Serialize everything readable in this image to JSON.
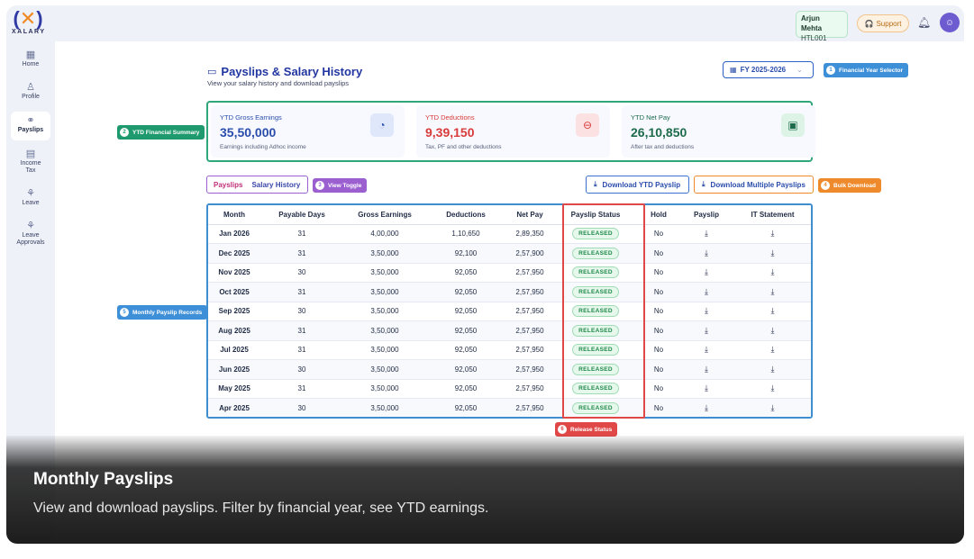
{
  "brand": {
    "logo_word": "XALARY"
  },
  "header": {
    "user_name": "Arjun Mehta",
    "user_id": "HTL001",
    "support_label": "Support"
  },
  "sidebar": {
    "items": [
      {
        "label": "Home",
        "icon": "grid-icon"
      },
      {
        "label": "Profile",
        "icon": "user-icon"
      },
      {
        "label": "Payslips",
        "icon": "payslip-icon",
        "active": true
      },
      {
        "label": "Income Tax",
        "icon": "calculator-icon"
      },
      {
        "label": "Leave",
        "icon": "leave-icon"
      },
      {
        "label": "Leave Approvals",
        "icon": "leave-approval-icon"
      }
    ]
  },
  "page": {
    "title": "Payslips & Salary History",
    "subtitle": "View your salary history and download payslips",
    "fy_select": "FY 2025-2026"
  },
  "summary": {
    "gross": {
      "label": "YTD Gross Earnings",
      "value": "35,50,000",
      "note": "Earnings including Adhoc income"
    },
    "deductions": {
      "label": "YTD Deductions",
      "value": "9,39,150",
      "note": "Tax, PF and other deductions"
    },
    "net": {
      "label": "YTD Net Pay",
      "value": "26,10,850",
      "note": "After tax and deductions"
    }
  },
  "toggle": {
    "payslips": "Payslips",
    "history": "Salary History"
  },
  "buttons": {
    "download_ytd": "Download YTD Payslip",
    "download_multiple": "Download Multiple Payslips"
  },
  "callouts": {
    "c1": {
      "num": "1",
      "label": "Financial Year Selector"
    },
    "c2": {
      "num": "2",
      "label": "YTD Financial Summary"
    },
    "c3": {
      "num": "3",
      "label": "View Toggle"
    },
    "c4": {
      "num": "4",
      "label": "Bulk Download"
    },
    "c5": {
      "num": "5",
      "label": "Monthly Payslip Records"
    },
    "c6": {
      "num": "6",
      "label": "Release Status"
    }
  },
  "table": {
    "headers": [
      "Month",
      "Payable Days",
      "Gross Earnings",
      "Deductions",
      "Net Pay",
      "Payslip Status",
      "Hold",
      "Payslip",
      "IT Statement"
    ],
    "rows": [
      {
        "month": "Jan 2026",
        "days": "31",
        "gross": "4,00,000",
        "deductions": "1,10,650",
        "net": "2,89,350",
        "status": "RELEASED",
        "hold": "No"
      },
      {
        "month": "Dec 2025",
        "days": "31",
        "gross": "3,50,000",
        "deductions": "92,100",
        "net": "2,57,900",
        "status": "RELEASED",
        "hold": "No"
      },
      {
        "month": "Nov 2025",
        "days": "30",
        "gross": "3,50,000",
        "deductions": "92,050",
        "net": "2,57,950",
        "status": "RELEASED",
        "hold": "No"
      },
      {
        "month": "Oct 2025",
        "days": "31",
        "gross": "3,50,000",
        "deductions": "92,050",
        "net": "2,57,950",
        "status": "RELEASED",
        "hold": "No"
      },
      {
        "month": "Sep 2025",
        "days": "30",
        "gross": "3,50,000",
        "deductions": "92,050",
        "net": "2,57,950",
        "status": "RELEASED",
        "hold": "No"
      },
      {
        "month": "Aug 2025",
        "days": "31",
        "gross": "3,50,000",
        "deductions": "92,050",
        "net": "2,57,950",
        "status": "RELEASED",
        "hold": "No"
      },
      {
        "month": "Jul 2025",
        "days": "31",
        "gross": "3,50,000",
        "deductions": "92,050",
        "net": "2,57,950",
        "status": "RELEASED",
        "hold": "No"
      },
      {
        "month": "Jun 2025",
        "days": "30",
        "gross": "3,50,000",
        "deductions": "92,050",
        "net": "2,57,950",
        "status": "RELEASED",
        "hold": "No"
      },
      {
        "month": "May 2025",
        "days": "31",
        "gross": "3,50,000",
        "deductions": "92,050",
        "net": "2,57,950",
        "status": "RELEASED",
        "hold": "No"
      },
      {
        "month": "Apr 2025",
        "days": "30",
        "gross": "3,50,000",
        "deductions": "92,050",
        "net": "2,57,950",
        "status": "RELEASED",
        "hold": "No"
      }
    ]
  },
  "overlay": {
    "title": "Monthly Payslips",
    "subtitle": "View and download payslips. Filter by financial year, see YTD earnings."
  },
  "colors": {
    "brand_blue": "#2136a0",
    "gross_blue": "#2a4dab",
    "deduction_red": "#d93a3a",
    "net_green": "#1d6b4a",
    "callout_blue": "#3d8fd8",
    "callout_green": "#1f9a6e",
    "callout_purple": "#9b5fd0",
    "callout_orange": "#ee8a2b",
    "callout_red": "#e04848"
  }
}
